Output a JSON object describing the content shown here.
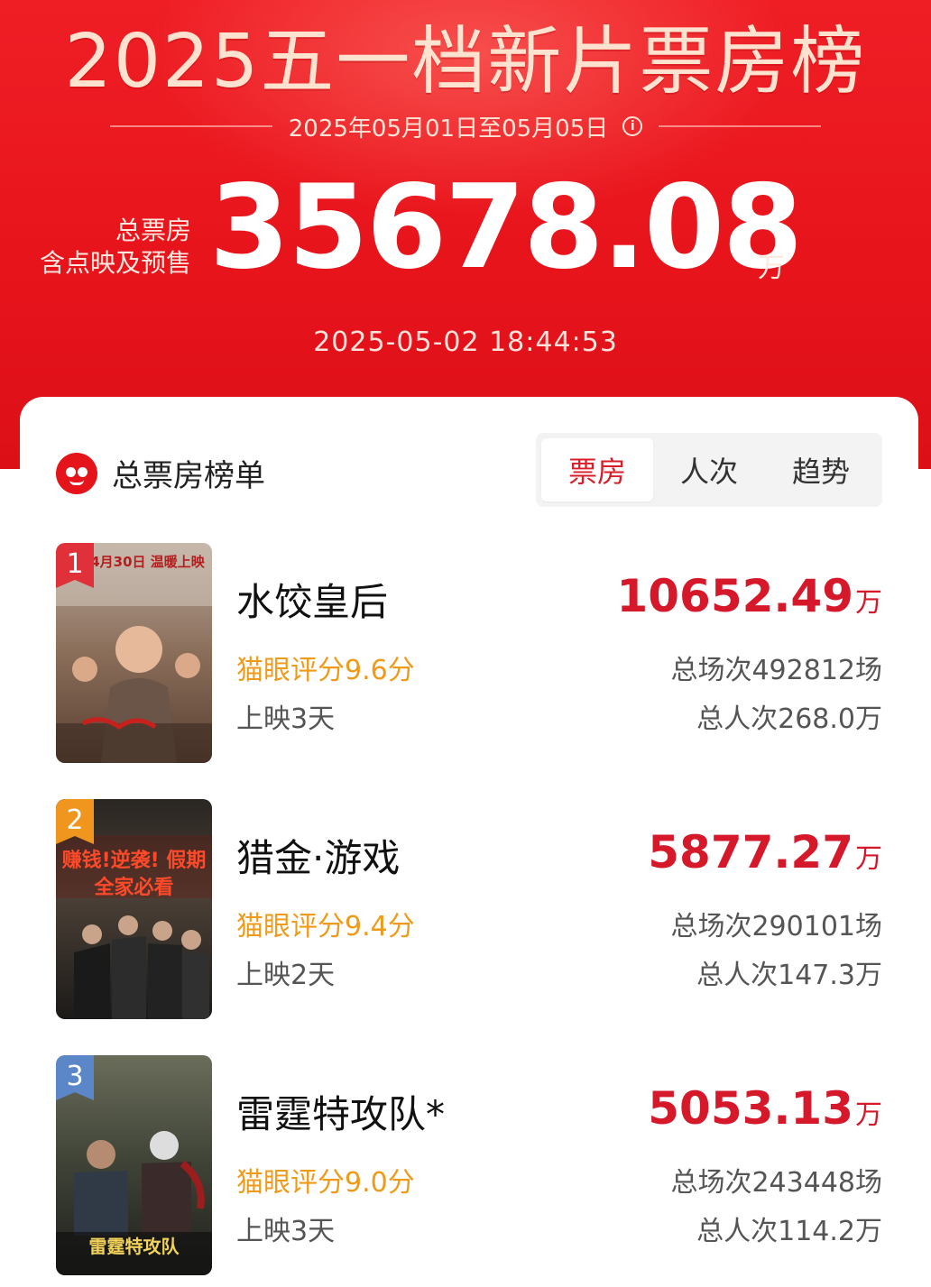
{
  "header": {
    "title": "2025五一档新片票房榜",
    "date_range": "2025年05月01日至05月05日",
    "total_label_1": "总票房",
    "total_label_2": "含点映及预售",
    "total_value": "35678.08",
    "total_unit": "万",
    "update_time": "2025-05-02  18:44:53"
  },
  "list": {
    "title": "总票房榜单",
    "tabs": [
      "票房",
      "人次",
      "趋势"
    ],
    "active_tab": "票房"
  },
  "movies": [
    {
      "rank": "1",
      "title": "水饺皇后",
      "rating": "猫眼评分9.6分",
      "days": "上映3天",
      "box": "10652.49",
      "unit": "万",
      "shows": "总场次492812场",
      "people": "总人次268.0万",
      "poster_text": "4月30日 温暖上映",
      "badge_color": "#e0313b"
    },
    {
      "rank": "2",
      "title": "猎金·游戏",
      "rating": "猫眼评分9.4分",
      "days": "上映2天",
      "box": "5877.27",
      "unit": "万",
      "shows": "总场次290101场",
      "people": "总人次147.3万",
      "poster_text": "赚钱!逆袭! 假期全家必看",
      "badge_color": "#f0951e"
    },
    {
      "rank": "3",
      "title": "雷霆特攻队*",
      "rating": "猫眼评分9.0分",
      "days": "上映3天",
      "box": "5053.13",
      "unit": "万",
      "shows": "总场次243448场",
      "people": "总人次114.2万",
      "poster_text": "雷霆特攻队",
      "badge_color": "#5b87c9"
    }
  ]
}
